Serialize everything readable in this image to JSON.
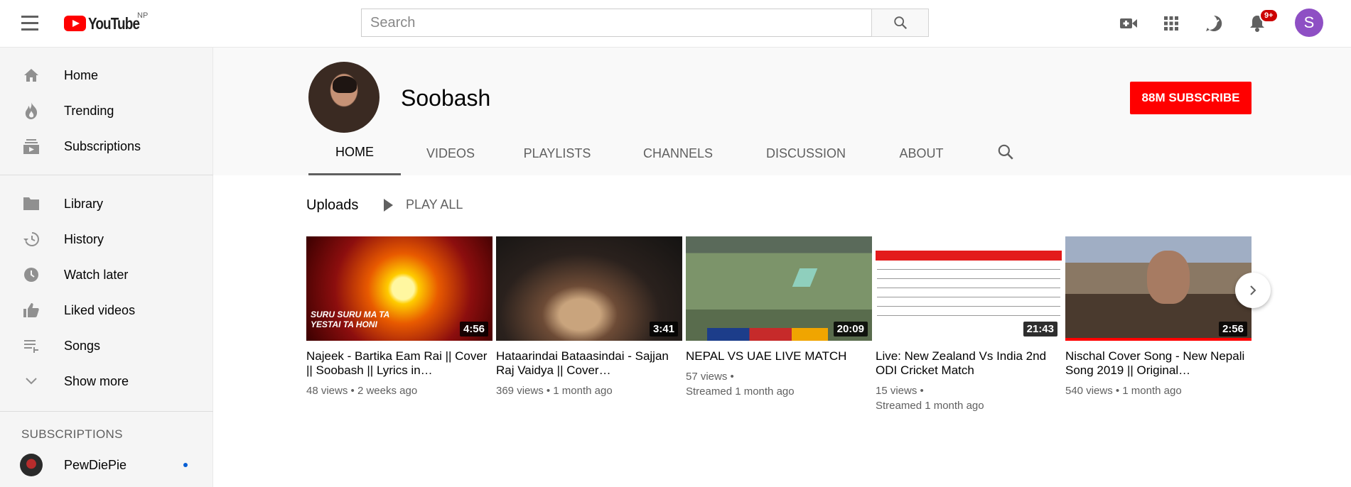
{
  "topbar": {
    "logo_text": "YouTube",
    "country": "NP",
    "search_placeholder": "Search",
    "notifications_badge": "9+",
    "avatar_letter": "S"
  },
  "sidebar": {
    "items": [
      {
        "label": "Home",
        "icon": "home-icon"
      },
      {
        "label": "Trending",
        "icon": "trending-icon"
      },
      {
        "label": "Subscriptions",
        "icon": "subscriptions-icon"
      },
      {
        "label": "Library",
        "icon": "library-icon"
      },
      {
        "label": "History",
        "icon": "history-icon"
      },
      {
        "label": "Watch later",
        "icon": "watch-later-icon"
      },
      {
        "label": "Liked videos",
        "icon": "liked-videos-icon"
      },
      {
        "label": "Songs",
        "icon": "playlist-icon"
      },
      {
        "label": "Show more",
        "icon": "chevron-down-icon"
      }
    ],
    "subscriptions_heading": "SUBSCRIPTIONS",
    "subscriptions": [
      {
        "name": "PewDiePie"
      }
    ]
  },
  "channel": {
    "name": "Soobash",
    "subscribe_label": "88M SUBSCRIBE",
    "tabs": [
      "HOME",
      "VIDEOS",
      "PLAYLISTS",
      "CHANNELS",
      "DISCUSSION",
      "ABOUT"
    ],
    "active_tab": "HOME"
  },
  "uploads": {
    "title": "Uploads",
    "play_all": "PLAY ALL",
    "videos": [
      {
        "title": "Najeek - Bartika Eam Rai || Cover || Soobash || Lyrics in…",
        "duration": "4:56",
        "meta_line1": "48 views • 2 weeks ago",
        "meta_line2": "",
        "thumb_caption": "SURU SURU MA TA\nYESTAI TA HONI"
      },
      {
        "title": "Hataarindai Bataasindai - Sajjan Raj Vaidya || Cover…",
        "duration": "3:41",
        "meta_line1": "369 views • 1 month ago",
        "meta_line2": ""
      },
      {
        "title": "NEPAL VS UAE LIVE MATCH",
        "duration": "20:09",
        "meta_line1": "57 views •",
        "meta_line2": "Streamed 1 month ago"
      },
      {
        "title": "Live: New Zealand Vs India 2nd ODI Cricket Match",
        "duration": "21:43",
        "meta_line1": "15 views •",
        "meta_line2": "Streamed 1 month ago"
      },
      {
        "title": "Nischal Cover Song - New Nepali Song 2019 || Original…",
        "duration": "2:56",
        "meta_line1": "540 views • 1 month ago",
        "meta_line2": ""
      }
    ]
  },
  "colors": {
    "brand_red": "#ff0000",
    "avatar_purple": "#8e4fc4",
    "text_secondary": "#606060"
  }
}
